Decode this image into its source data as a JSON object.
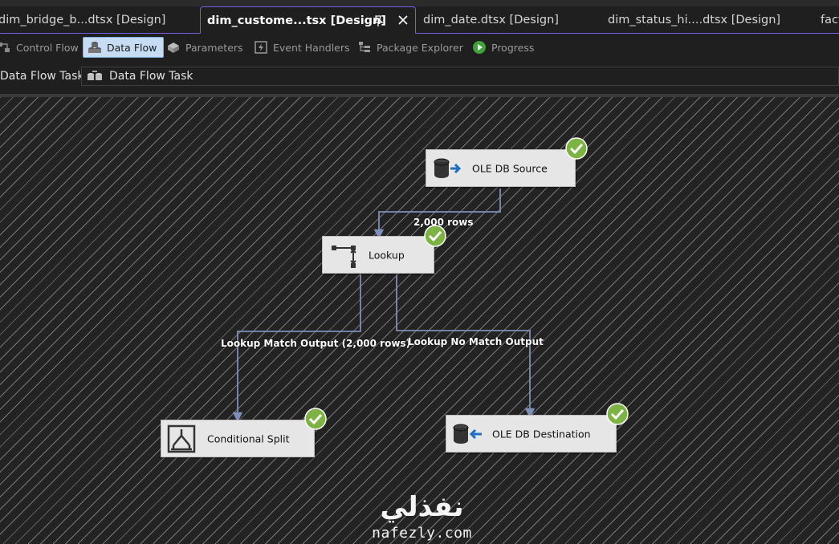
{
  "tabs": [
    {
      "label": "dim_bridge_b...dtsx [Design]"
    },
    {
      "label": "dim_custome...tsx [Design]"
    },
    {
      "label": "dim_date.dtsx [Design]"
    },
    {
      "label": "dim_status_hi....dtsx [Design]"
    },
    {
      "label": "fact"
    }
  ],
  "toolbar": {
    "control_flow": "Control Flow",
    "data_flow": "Data Flow",
    "parameters": "Parameters",
    "event_handlers": "Event Handlers",
    "package_explorer": "Package Explorer",
    "progress": "Progress"
  },
  "task": {
    "label": "Data Flow Task:",
    "value": "Data Flow Task"
  },
  "nodes": {
    "ole_db_source": "OLE DB Source",
    "lookup": "Lookup",
    "conditional_split": "Conditional Split",
    "ole_db_destination": "OLE DB Destination"
  },
  "paths": {
    "source_to_lookup": "2,000 rows",
    "match_output": "Lookup Match Output (2,000 rows)",
    "no_match_output": "Lookup No Match Output"
  },
  "watermark": {
    "arabic": "نفذلي",
    "latin": "nafezly.com"
  },
  "colors": {
    "accent_tab": "#7160e8",
    "success_green": "#7cb342",
    "connector": "#7d8fb8"
  }
}
